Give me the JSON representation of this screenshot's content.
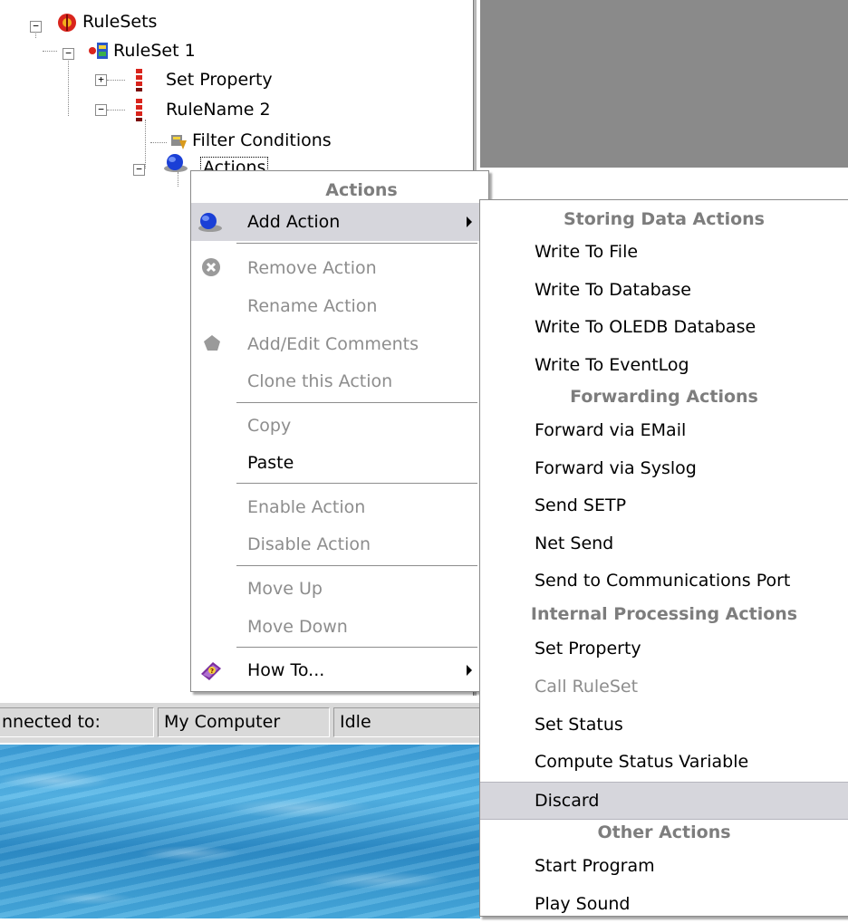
{
  "tree": {
    "items": [
      {
        "label": "RuleSets",
        "icon": "rulesets-icon"
      },
      {
        "label": "RuleSet 1",
        "icon": "ruleset-icon"
      },
      {
        "label": "Set Property",
        "icon": "rule-icon"
      },
      {
        "label": "RuleName 2",
        "icon": "rule-icon"
      },
      {
        "label": "Filter Conditions",
        "icon": "filter-icon"
      },
      {
        "label": "Actions",
        "icon": "actions-globe-icon"
      }
    ]
  },
  "status_bar": {
    "connection_label": "nnected to:",
    "computer": "My Computer",
    "state": "Idle"
  },
  "context_menu": {
    "header": "Actions",
    "add_action": "Add Action",
    "remove_action": "Remove Action",
    "rename_action": "Rename Action",
    "add_edit_comments": "Add/Edit Comments",
    "clone_action": "Clone this Action",
    "copy": "Copy",
    "paste": "Paste",
    "enable_action": "Enable Action",
    "disable_action": "Disable Action",
    "move_up": "Move Up",
    "move_down": "Move Down",
    "how_to": "How To..."
  },
  "submenu": {
    "storing_header": "Storing Data Actions",
    "write_to_file": "Write To File",
    "write_to_database": "Write To Database",
    "write_to_oledb": "Write To OLEDB Database",
    "write_to_eventlog": "Write To EventLog",
    "forwarding_header": "Forwarding Actions",
    "forward_email": "Forward via EMail",
    "forward_syslog": "Forward via Syslog",
    "send_setp": "Send SETP",
    "net_send": "Net Send",
    "send_comm_port": "Send to Communications Port",
    "internal_header": "Internal Processing Actions",
    "set_property": "Set Property",
    "call_ruleset": "Call RuleSet",
    "set_status": "Set Status",
    "compute_status": "Compute Status Variable",
    "discard": "Discard",
    "other_header": "Other Actions",
    "start_program": "Start Program",
    "play_sound": "Play Sound"
  },
  "colors": {
    "highlight": "#d6d6dc",
    "disabled_text": "#8d8d8d",
    "header_text": "#7d7d7d",
    "panel_gray": "#8a8a8a"
  }
}
